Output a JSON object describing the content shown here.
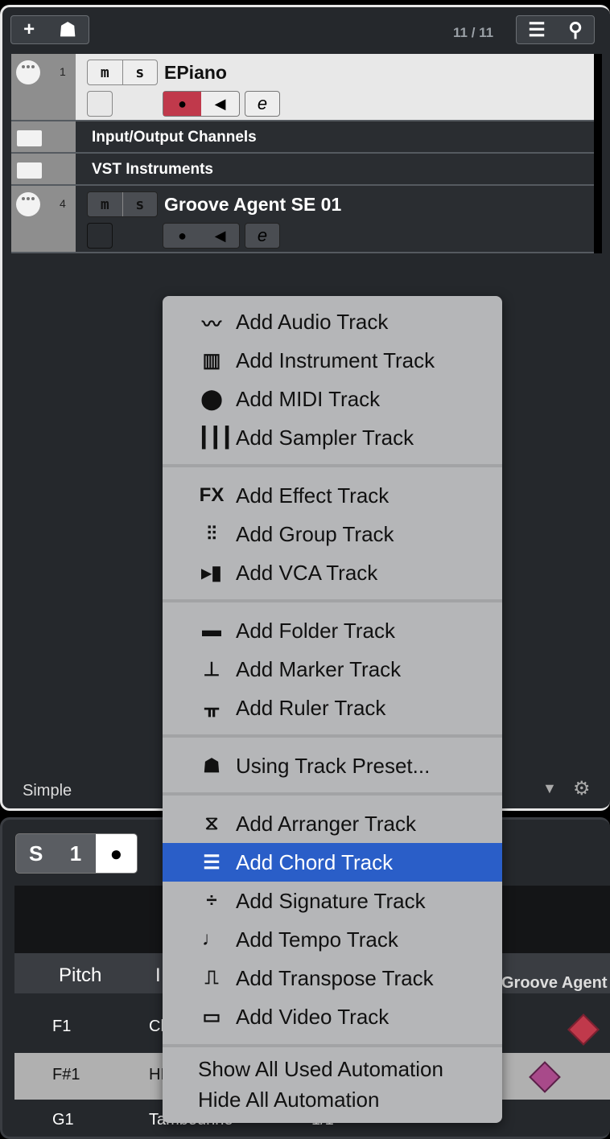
{
  "toolbar": {
    "add_icon": "plus-icon",
    "preset_icon": "track-preset-icon",
    "count": "11 / 11",
    "list_icon": "list-icon",
    "search_icon": "search-icon"
  },
  "tracks": [
    {
      "number": "1",
      "name": "EPiano",
      "type": "midi",
      "mute": "m",
      "solo": "s",
      "selected": true,
      "record_enabled": true
    },
    {
      "name": "Input/Output Channels",
      "type": "folder"
    },
    {
      "name": "VST Instruments",
      "type": "folder"
    },
    {
      "number": "4",
      "name": "Groove Agent SE 01",
      "type": "midi",
      "mute": "m",
      "solo": "s",
      "selected": false,
      "record_enabled": false
    }
  ],
  "footer": {
    "mode": "Simple"
  },
  "lower": {
    "buttons": [
      "S",
      "1"
    ],
    "columns": [
      "Pitch",
      "I"
    ],
    "rows": [
      {
        "pitch": "F1",
        "instrument": "Cl"
      },
      {
        "pitch": "F#1",
        "instrument": "HI"
      },
      {
        "pitch": "G1",
        "instrument": "Tambourine",
        "q": "1/1"
      }
    ],
    "track_label": "Groove Agent S"
  },
  "menu": {
    "groups": [
      [
        {
          "label": "Add Audio Track",
          "icon": "waveform-icon"
        },
        {
          "label": "Add Instrument Track",
          "icon": "piano-keys-icon"
        },
        {
          "label": "Add MIDI Track",
          "icon": "midi-icon"
        },
        {
          "label": "Add Sampler Track",
          "icon": "sampler-icon"
        }
      ],
      [
        {
          "label": "Add Effect Track",
          "icon": "fx-icon"
        },
        {
          "label": "Add Group Track",
          "icon": "group-faders-icon"
        },
        {
          "label": "Add VCA Track",
          "icon": "vca-icon"
        }
      ],
      [
        {
          "label": "Add Folder Track",
          "icon": "folder-icon"
        },
        {
          "label": "Add Marker Track",
          "icon": "marker-icon"
        },
        {
          "label": "Add Ruler Track",
          "icon": "ruler-icon"
        }
      ],
      [
        {
          "label": "Using Track Preset...",
          "icon": "track-preset-icon"
        }
      ],
      [
        {
          "label": "Add Arranger Track",
          "icon": "arranger-icon"
        },
        {
          "label": "Add Chord Track",
          "icon": "chord-icon",
          "highlighted": true
        },
        {
          "label": "Add Signature Track",
          "icon": "signature-icon"
        },
        {
          "label": "Add Tempo Track",
          "icon": "note-icon"
        },
        {
          "label": "Add Transpose Track",
          "icon": "transpose-icon"
        },
        {
          "label": "Add Video Track",
          "icon": "film-icon"
        }
      ],
      [
        {
          "label": "Show All Used Automation"
        },
        {
          "label": "Hide All Automation"
        }
      ]
    ]
  },
  "colors": {
    "highlight": "#2a5ec8",
    "record": "#c0394b"
  }
}
